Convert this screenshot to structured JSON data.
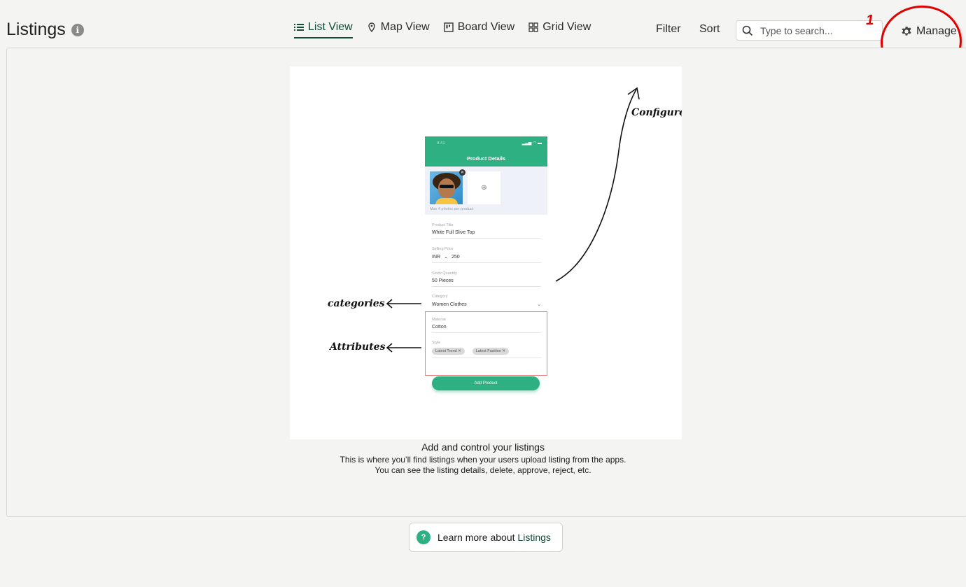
{
  "header": {
    "title": "Listings",
    "info_icon": "info-icon"
  },
  "tabs": [
    {
      "label": "List View",
      "icon": "list-icon",
      "active": true
    },
    {
      "label": "Map View",
      "icon": "map-pin-icon",
      "active": false
    },
    {
      "label": "Board View",
      "icon": "board-icon",
      "active": false
    },
    {
      "label": "Grid View",
      "icon": "grid-icon",
      "active": false
    }
  ],
  "toolbar": {
    "filter_label": "Filter",
    "sort_label": "Sort",
    "search_placeholder": "Type to search...",
    "manage_label": "Manage",
    "annotation_number": "1"
  },
  "illustration": {
    "phone": {
      "status_time": "9:41",
      "header_title": "Product Details",
      "photo_caption": "Max 4 photos per product",
      "fields": [
        {
          "label": "Product Title",
          "value": "White Full Slive Top"
        },
        {
          "label": "Selling Price",
          "currency": "INR",
          "value": "250"
        },
        {
          "label": "Stock Quantity",
          "value": "50 Pieces"
        },
        {
          "label": "Category",
          "value": "Women Clothes"
        },
        {
          "label": "Material",
          "value": "Cotton"
        },
        {
          "label": "Style",
          "chips": [
            "Latest Trend",
            "Latest Fashion"
          ]
        }
      ],
      "add_button": "Add Product"
    },
    "labels": {
      "configure": "Configure",
      "categories": "categories",
      "attributes": "Attributes"
    }
  },
  "empty_state": {
    "title": "Add and control your listings",
    "line1": "This is where you’ll find listings when your users upload listing from the apps.",
    "line2": "You can see the listing details, delete, approve, reject, etc."
  },
  "learn_more": {
    "prefix": "Learn more about",
    "link": "Listings"
  },
  "colors": {
    "accent": "#124a3a",
    "brand_green": "#2eb083",
    "annotation_red": "#e00000"
  }
}
